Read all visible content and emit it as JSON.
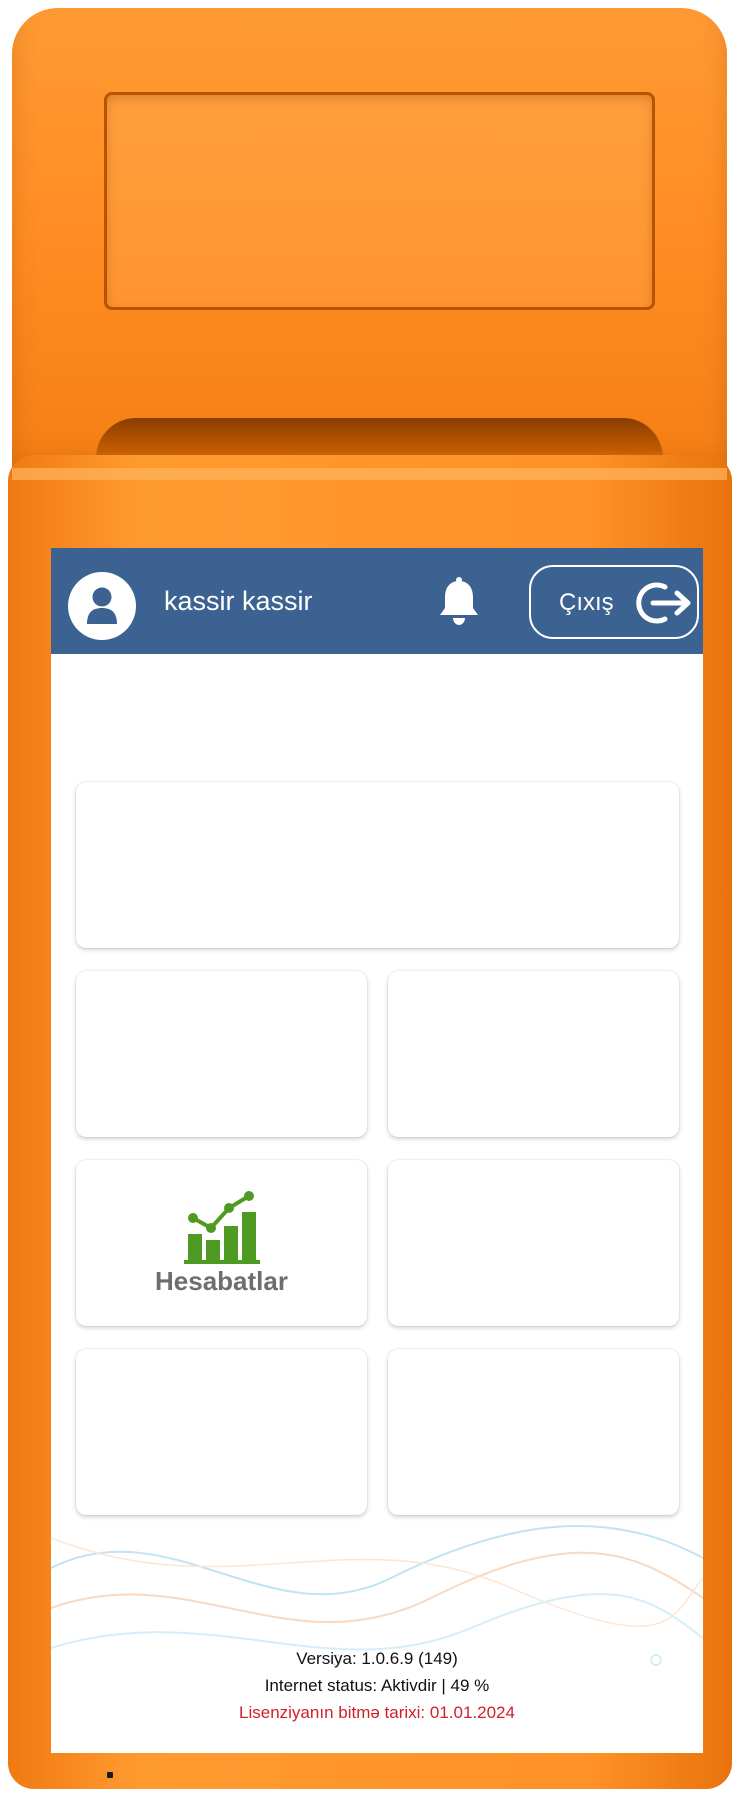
{
  "header": {
    "username": "kassir kassir",
    "logout_label": "Çıxış",
    "avatar_icon": "user-avatar-icon",
    "notification_icon": "bell-icon",
    "logout_icon": "logout-icon",
    "background_color": "#3c6292"
  },
  "tiles": {
    "reports": {
      "label": "Hesabatlar",
      "icon": "bar-chart-growth-icon",
      "icon_color": "#4e9a22"
    }
  },
  "footer": {
    "version": "Versiya: 1.0.6.9 (149)",
    "internet_status": "Internet status: Aktivdir | 49 %",
    "license_expiry": "Lisenziyanın bitmə tarixi: 01.01.2024",
    "license_color": "#d0202a"
  },
  "device": {
    "body_color": "#ff9228"
  }
}
